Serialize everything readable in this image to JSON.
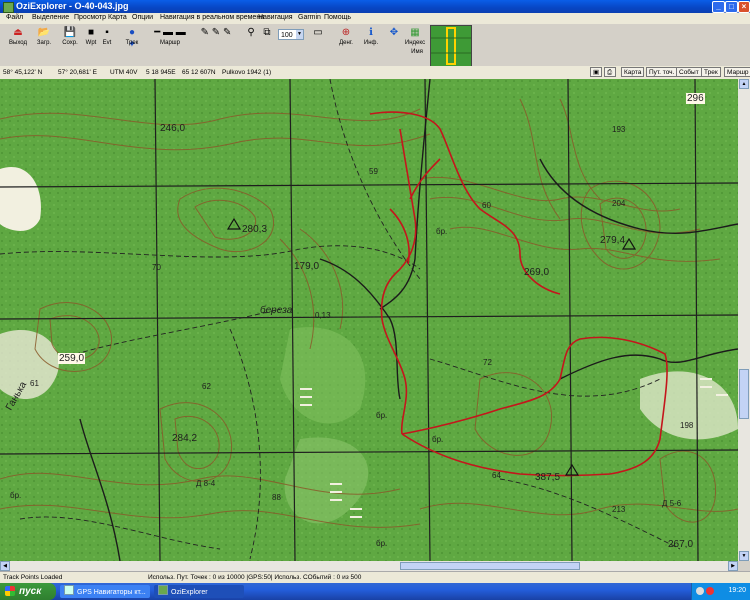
{
  "window": {
    "title": "OziExplorer - O-40-043.jpg"
  },
  "menu": [
    "Файл",
    "Выделение",
    "Просмотр",
    "Карта",
    "Опции",
    "Навигация в реальном времени",
    "Навигация",
    "Garmin",
    "Помощь"
  ],
  "toolbar": {
    "buttons": [
      {
        "label": "Выход",
        "icon": "exit-icon"
      },
      {
        "label": "Загр.",
        "icon": "load-icon"
      },
      {
        "label": "Сохр.",
        "icon": "save-icon"
      },
      {
        "label": "Wpt",
        "icon": "waypoint-icon"
      },
      {
        "label": "Evt",
        "icon": "event-icon"
      },
      {
        "label": "Трек",
        "icon": "track-icon"
      },
      {
        "label": "Маршр",
        "icon": "route-icon"
      },
      {
        "label": "Денг.",
        "icon": "move-icon"
      },
      {
        "label": "Инф.",
        "icon": "info-icon"
      },
      {
        "label": "Индекс",
        "icon": "index-icon"
      },
      {
        "label": "Имя",
        "icon": "name-icon"
      }
    ],
    "zoom": "100"
  },
  "coords": {
    "lat": "58° 45,122' N",
    "lon": "57° 20,681' E",
    "utm": "UTM  40V",
    "easting": "5 18 945E",
    "northing": "65 12 607N",
    "datum": "Pulkovo 1942 (1)"
  },
  "view_tabs": [
    "Карта",
    "Пут. точ.",
    "Событ",
    "Трек",
    "Маршр"
  ],
  "map_labels": [
    {
      "name": "elevation-296",
      "text": "296"
    },
    {
      "name": "elevation-246",
      "text": "246,0"
    },
    {
      "name": "elevation-193",
      "text": "193"
    },
    {
      "name": "elevation-59",
      "text": "59"
    },
    {
      "name": "elevation-204",
      "text": "204"
    },
    {
      "name": "elevation-280",
      "text": "280,3"
    },
    {
      "name": "elevation-60a",
      "text": "60"
    },
    {
      "name": "label-br-1",
      "text": "бр."
    },
    {
      "name": "elevation-279",
      "text": "279,4"
    },
    {
      "name": "elevation-269",
      "text": "269,0"
    },
    {
      "name": "elevation-179",
      "text": "179,0"
    },
    {
      "name": "elevation-70",
      "text": "70"
    },
    {
      "name": "label-bereza",
      "text": "береза"
    },
    {
      "name": "label-bereza-num",
      "text": "0,13"
    },
    {
      "name": "elevation-259",
      "text": "259,0"
    },
    {
      "name": "elevation-61",
      "text": "61"
    },
    {
      "name": "elevation-62",
      "text": "62"
    },
    {
      "name": "elevation-72",
      "text": "72"
    },
    {
      "name": "label-br-2",
      "text": "бр."
    },
    {
      "name": "label-br-3",
      "text": "бр."
    },
    {
      "name": "elevation-284",
      "text": "284,2"
    },
    {
      "name": "elevation-198",
      "text": "198"
    },
    {
      "name": "elevation-387",
      "text": "387,5"
    },
    {
      "name": "elevation-64",
      "text": "64"
    },
    {
      "name": "label-forest",
      "text": "Д 5-6"
    },
    {
      "name": "elevation-213",
      "text": "213"
    },
    {
      "name": "elevation-88",
      "text": "88"
    },
    {
      "name": "label-br-4",
      "text": "бр."
    },
    {
      "name": "label-br-5",
      "text": "бр."
    },
    {
      "name": "elevation-267",
      "text": "267,0"
    },
    {
      "name": "label-river",
      "text": "Ганька"
    },
    {
      "name": "label-dot-5",
      "text": "Д 8-4"
    }
  ],
  "status": {
    "left": "Track Points Loaded",
    "middle": "Использ. Пут. Точек : 0 из 10000  |GPS:50| Использ. СОбытий : 0 из 500"
  },
  "taskbar": {
    "start": "пуск",
    "windows": [
      "GPS Навигаторы кт...",
      "OziExplorer"
    ],
    "clock": "19:20"
  }
}
